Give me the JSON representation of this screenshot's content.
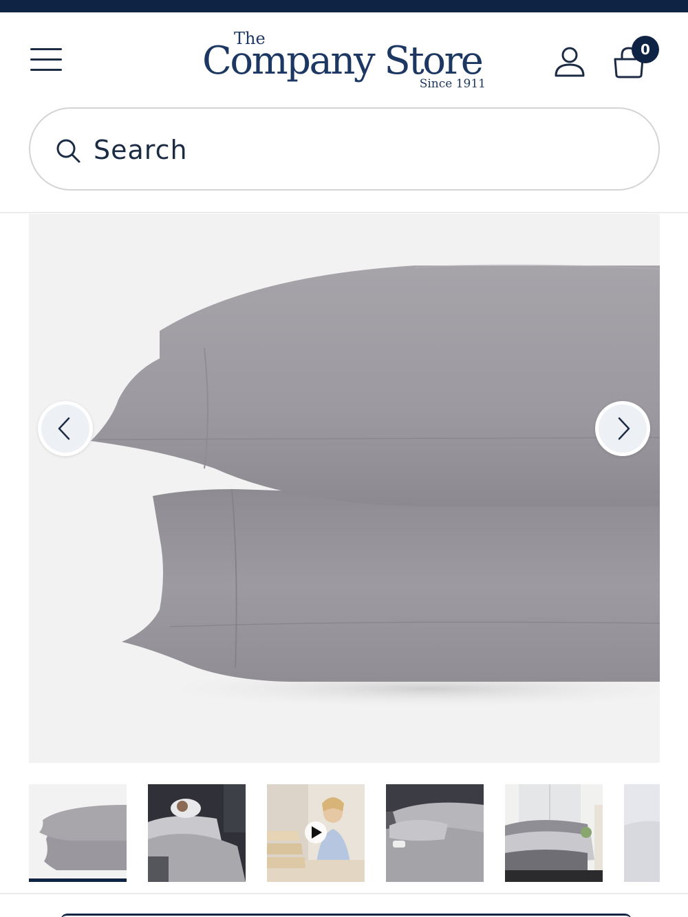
{
  "header": {
    "menu_icon": "hamburger-menu-icon",
    "logo": {
      "the": "The",
      "name": "Company Store",
      "tagline": "Since 1911"
    },
    "account_icon": "user-icon",
    "cart_icon": "shopping-bag-icon",
    "cart_count": "0"
  },
  "search": {
    "placeholder": "Search",
    "icon": "search-icon"
  },
  "gallery": {
    "main_image": "gray pillowcases stacked",
    "prev_icon": "chevron-left-icon",
    "next_icon": "chevron-right-icon",
    "thumbnails": [
      {
        "subject": "gray pillowcases stacked",
        "active": true
      },
      {
        "subject": "woman sleeping in gray bedding",
        "active": false
      },
      {
        "subject": "product video with presenter",
        "active": false,
        "video": true
      },
      {
        "subject": "gray bedding close-up",
        "active": false
      },
      {
        "subject": "bedroom with gray bedding",
        "active": false
      },
      {
        "subject": "partial thumbnail",
        "active": false
      }
    ]
  },
  "colors": {
    "navy": "#0f2444",
    "brand": "#1d3763",
    "pillow": "#9d9ba0",
    "hero_bg": "#f2f2f2"
  }
}
